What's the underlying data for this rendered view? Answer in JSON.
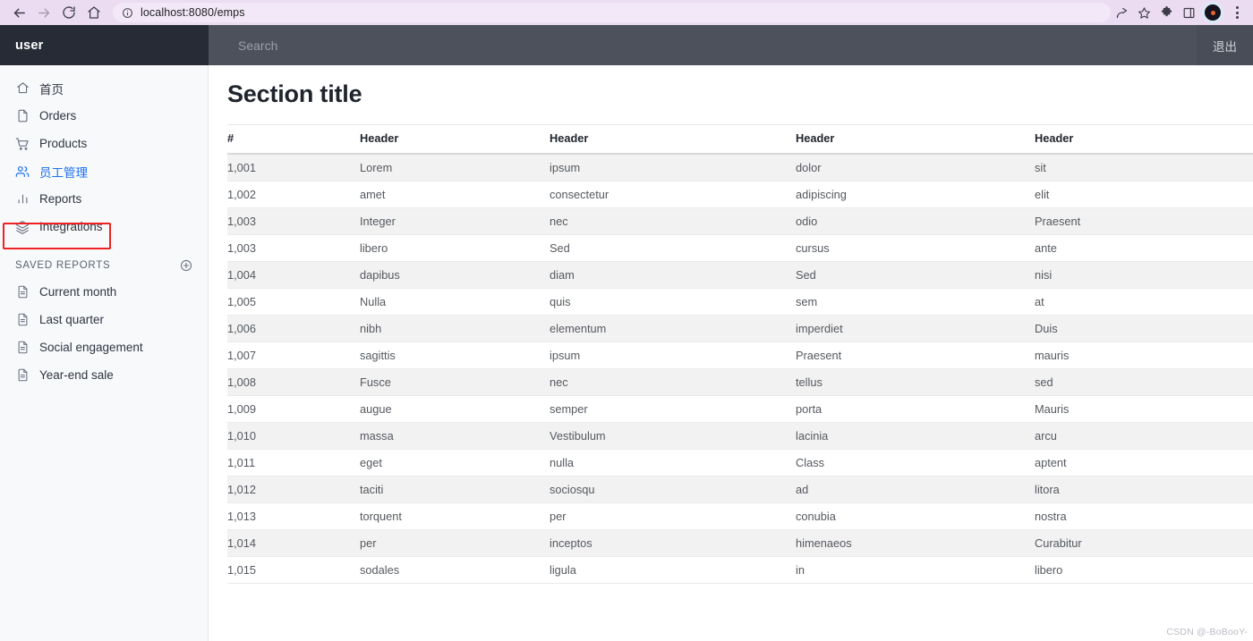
{
  "browser": {
    "url": "localhost:8080/emps",
    "back_label": "Back",
    "forward_label": "Forward",
    "reload_label": "Reload",
    "home_label": "Home",
    "site_info_label": "View site information",
    "share_label": "Share this page",
    "bookmark_label": "Bookmark this tab",
    "extensions_label": "Extensions",
    "side_panel_label": "Side panel",
    "profile_label": "Profile",
    "menu_label": "Customize and control"
  },
  "app": {
    "brand": "user",
    "logout_label": "退出"
  },
  "search": {
    "value": "",
    "placeholder": "Search"
  },
  "sidebar": {
    "items": [
      {
        "label": "首页",
        "icon": "home-icon",
        "active": false
      },
      {
        "label": "Orders",
        "icon": "file-icon",
        "active": false
      },
      {
        "label": "Products",
        "icon": "shopping-cart-icon",
        "active": false
      },
      {
        "label": "员工管理",
        "icon": "users-icon",
        "active": true
      },
      {
        "label": "Reports",
        "icon": "bar-chart-icon",
        "active": false
      },
      {
        "label": "Integrations",
        "icon": "layers-icon",
        "active": false
      }
    ],
    "saved_reports": {
      "title": "SAVED REPORTS",
      "add_label": "Add saved report",
      "items": [
        {
          "label": "Current month",
          "icon": "file-text-icon"
        },
        {
          "label": "Last quarter",
          "icon": "file-text-icon"
        },
        {
          "label": "Social engagement",
          "icon": "file-text-icon"
        },
        {
          "label": "Year-end sale",
          "icon": "file-text-icon"
        }
      ]
    }
  },
  "main": {
    "section_title": "Section title",
    "table": {
      "columns": [
        "#",
        "Header",
        "Header",
        "Header",
        "Header"
      ],
      "rows": [
        [
          "1,001",
          "Lorem",
          "ipsum",
          "dolor",
          "sit"
        ],
        [
          "1,002",
          "amet",
          "consectetur",
          "adipiscing",
          "elit"
        ],
        [
          "1,003",
          "Integer",
          "nec",
          "odio",
          "Praesent"
        ],
        [
          "1,003",
          "libero",
          "Sed",
          "cursus",
          "ante"
        ],
        [
          "1,004",
          "dapibus",
          "diam",
          "Sed",
          "nisi"
        ],
        [
          "1,005",
          "Nulla",
          "quis",
          "sem",
          "at"
        ],
        [
          "1,006",
          "nibh",
          "elementum",
          "imperdiet",
          "Duis"
        ],
        [
          "1,007",
          "sagittis",
          "ipsum",
          "Praesent",
          "mauris"
        ],
        [
          "1,008",
          "Fusce",
          "nec",
          "tellus",
          "sed"
        ],
        [
          "1,009",
          "augue",
          "semper",
          "porta",
          "Mauris"
        ],
        [
          "1,010",
          "massa",
          "Vestibulum",
          "lacinia",
          "arcu"
        ],
        [
          "1,011",
          "eget",
          "nulla",
          "Class",
          "aptent"
        ],
        [
          "1,012",
          "taciti",
          "sociosqu",
          "ad",
          "litora"
        ],
        [
          "1,013",
          "torquent",
          "per",
          "conubia",
          "nostra"
        ],
        [
          "1,014",
          "per",
          "inceptos",
          "himenaeos",
          "Curabitur"
        ],
        [
          "1,015",
          "sodales",
          "ligula",
          "in",
          "libero"
        ]
      ]
    }
  },
  "watermark": "CSDN @-BoBooY-",
  "colors": {
    "chrome_bg": "#ecdcf2",
    "brand_bg": "#262b35",
    "topbar_bg": "#4c515b",
    "sidebar_bg": "#f8f9fb",
    "active_link": "#1c6ff0",
    "highlight_box": "#ee2222",
    "row_stripe": "#f2f2f2"
  }
}
